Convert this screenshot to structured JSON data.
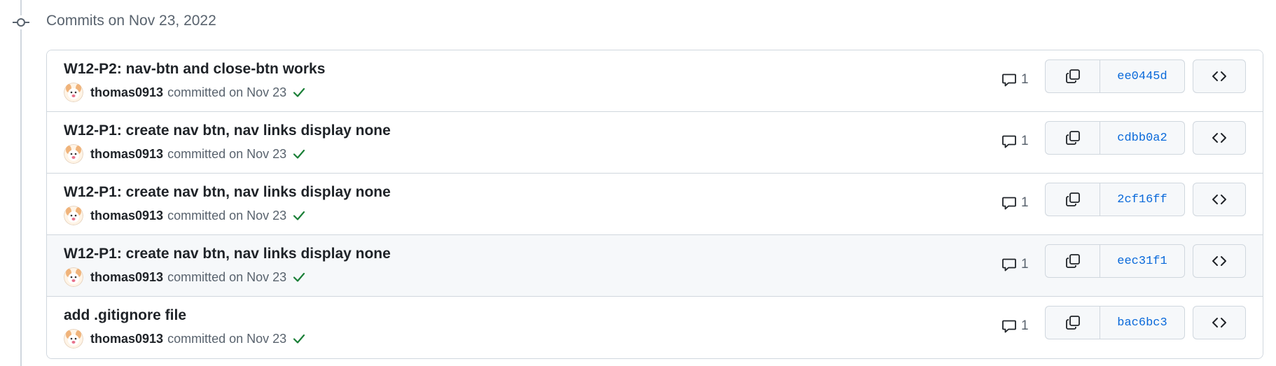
{
  "group": {
    "title": "Commits on Nov 23, 2022"
  },
  "commits": [
    {
      "message": "W12-P2: nav-btn and close-btn works",
      "author": "thomas0913",
      "committed": "committed on Nov 23",
      "comments": "1",
      "sha": "ee0445d"
    },
    {
      "message": "W12-P1: create nav btn, nav links display none",
      "author": "thomas0913",
      "committed": "committed on Nov 23",
      "comments": "1",
      "sha": "cdbb0a2"
    },
    {
      "message": "W12-P1: create nav btn, nav links display none",
      "author": "thomas0913",
      "committed": "committed on Nov 23",
      "comments": "1",
      "sha": "2cf16ff"
    },
    {
      "message": "W12-P1: create nav btn, nav links display none",
      "author": "thomas0913",
      "committed": "committed on Nov 23",
      "comments": "1",
      "sha": "eec31f1"
    },
    {
      "message": "add .gitignore file",
      "author": "thomas0913",
      "committed": "committed on Nov 23",
      "comments": "1",
      "sha": "bac6bc3"
    }
  ],
  "icons": {
    "timeline": "git-commit-icon",
    "avatar": "avatar",
    "status": "check-icon",
    "comment": "comment-icon",
    "copy": "copy-icon",
    "browse": "code-icon"
  },
  "colors": {
    "link": "#0969da",
    "success": "#1a7f37",
    "muted": "#59636e",
    "border": "#d0d7de"
  }
}
